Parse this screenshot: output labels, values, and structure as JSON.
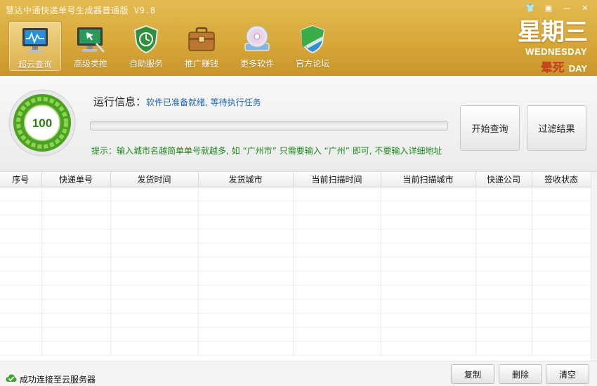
{
  "app": {
    "title": "慧达中通快递单号生成器普通版 V9.8"
  },
  "window_controls": [
    {
      "name": "skin-button",
      "icon": "shirt-icon",
      "glyph": "👕"
    },
    {
      "name": "restore-button",
      "icon": "window-icon",
      "glyph": "▣"
    },
    {
      "name": "minimize-button",
      "icon": "minimize-icon",
      "glyph": "—"
    },
    {
      "name": "close-button",
      "icon": "close-icon",
      "glyph": "✕"
    }
  ],
  "toolbar": {
    "items": [
      {
        "label": "超云查询",
        "icon": "monitor-chart-icon",
        "active": true
      },
      {
        "label": "高级类推",
        "icon": "monitor-cursor-icon",
        "active": false
      },
      {
        "label": "自助服务",
        "icon": "shield-clock-icon",
        "active": false
      },
      {
        "label": "推广赚钱",
        "icon": "briefcase-icon",
        "active": false
      },
      {
        "label": "更多软件",
        "icon": "disc-icon",
        "active": false
      },
      {
        "label": "官方论坛",
        "icon": "shield-icon",
        "active": false
      }
    ]
  },
  "weekday": {
    "cn": "星期三",
    "en": "WEDNESDAY",
    "mood": "晕死",
    "day": "DAY"
  },
  "status_panel": {
    "score": "100",
    "run_label": "运行信息：",
    "run_status": "软件已准备就绪, 等待执行任务",
    "progress": 0,
    "tip": "提示：输入城市名越简单单号就越多, 如 “广州市” 只需要输入 “广州” 即可, 不要输入详细地址",
    "start_button": "开始查询",
    "filter_button": "过滤结果"
  },
  "table": {
    "columns": [
      "序号",
      "快递单号",
      "发货时间",
      "发货城市",
      "当前扫描时间",
      "当前扫描城市",
      "快递公司",
      "签收状态"
    ],
    "rows": []
  },
  "footer": {
    "connection_status": "成功连接至云服务器",
    "copy_button": "复制",
    "delete_button": "删除",
    "clear_button": "清空"
  },
  "colors": {
    "header_gold": "#d8a83a",
    "accent_green": "#4da127",
    "status_blue": "#1f67b5",
    "tip_green": "#1e8a1e"
  }
}
